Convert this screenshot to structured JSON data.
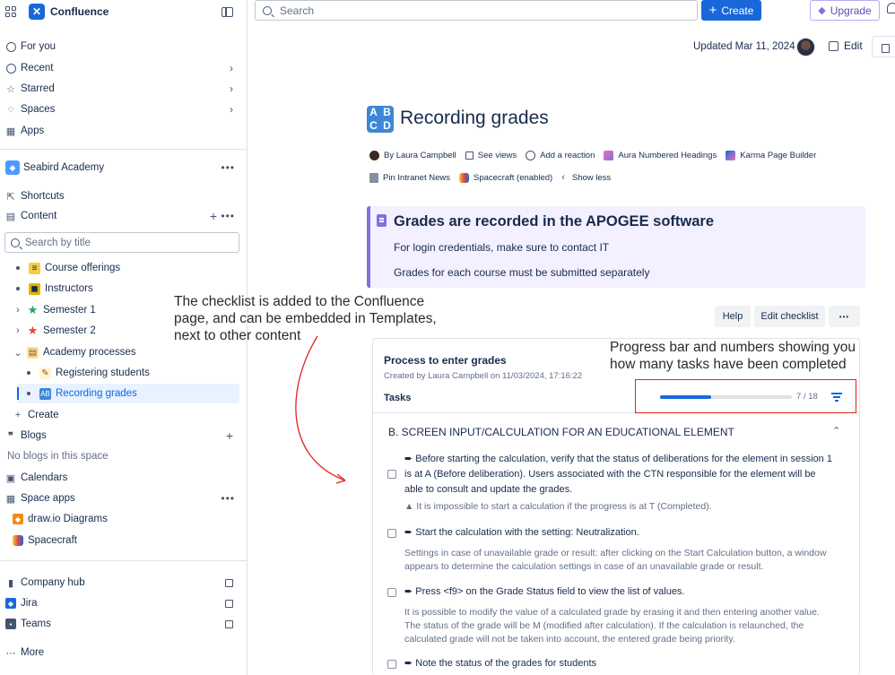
{
  "sidebar": {
    "app_name": "Confluence",
    "nav": [
      {
        "label": "For you"
      },
      {
        "label": "Recent"
      },
      {
        "label": "Starred"
      },
      {
        "label": "Spaces"
      },
      {
        "label": "Apps"
      }
    ],
    "space_name": "Seabird Academy",
    "shortcuts": "Shortcuts",
    "content": "Content",
    "search_placeholder": "Search by title",
    "tree": [
      {
        "label": "Course offerings"
      },
      {
        "label": "Instructors"
      },
      {
        "label": "Semester 1"
      },
      {
        "label": "Semester 2"
      },
      {
        "label": "Academy processes"
      },
      {
        "label": "Registering students"
      },
      {
        "label": "Recording grades"
      }
    ],
    "create": "Create",
    "blogs": "Blogs",
    "no_blogs": "No blogs in this space",
    "calendars": "Calendars",
    "space_apps": "Space apps",
    "apps": [
      {
        "label": "draw.io Diagrams"
      },
      {
        "label": "Spacecraft"
      }
    ],
    "bottom": [
      {
        "label": "Company hub"
      },
      {
        "label": "Jira"
      },
      {
        "label": "Teams"
      }
    ],
    "more": "More"
  },
  "topbar": {
    "search_placeholder": "Search",
    "create_label": "Create",
    "upgrade_label": "Upgrade"
  },
  "header": {
    "updated": "Updated Mar 11, 2024",
    "edit_label": "Edit"
  },
  "page": {
    "emoji": [
      "A",
      "B",
      "C",
      "D"
    ],
    "title": "Recording grades",
    "byline_row1": [
      {
        "label": "By Laura Campbell"
      },
      {
        "label": "See views"
      },
      {
        "label": "Add a reaction"
      },
      {
        "label": "Aura Numbered Headings"
      },
      {
        "label": "Karma Page Builder"
      }
    ],
    "byline_row2": [
      {
        "label": "Pin Intranet News"
      },
      {
        "label": "Spacecraft (enabled)"
      },
      {
        "label": "Show less"
      }
    ],
    "panel": {
      "heading": "Grades are recorded in the APOGEE software",
      "line1": "For login credentials, make sure to contact IT",
      "line2": "Grades for each course must be submitted separately"
    }
  },
  "checklist": {
    "help_label": "Help",
    "edit_label": "Edit checklist",
    "more_label": "•••",
    "title": "Process to enter grades",
    "meta": "Created by Laura Campbell on 11/03/2024, 17:16:22",
    "tasks_label": "Tasks",
    "progress_done": 7,
    "progress_total": 18,
    "progress_text": "7 / 18",
    "section": "B. SCREEN INPUT/CALCULATION FOR AN EDUCATIONAL ELEMENT",
    "items": [
      {
        "text": "➨ Before starting the calculation, verify that the status of deliberations for the element in session 1 is at A (Before deliberation). Users associated with the CTN responsible for the element will be able to consult and update the grades.",
        "note": "▲ It is impossible to start a calculation if the progress is at T (Completed)."
      },
      {
        "text": "➨ Start the calculation with the setting: Neutralization.",
        "note": "Settings in case of unavailable grade or result: after clicking on the Start Calculation button, a window appears to determine the calculation settings in case of an unavailable grade or result."
      },
      {
        "text": "➨ Press <f9> on the Grade Status field to view the list of values.",
        "note": "It is possible to modify the value of a calculated grade by erasing it and then entering another value. The status of the grade will be M (modified after calculation). If the calculation is relaunched, the calculated grade will not be taken into account, the entered grade being priority."
      },
      {
        "text": "➨ Note the status of the grades for students",
        "note": ""
      }
    ]
  },
  "annotations": {
    "left": "The checklist is added to the Confluence page, and can be embedded in Templates, next to other content",
    "right": "Progress bar and numbers showing you how many tasks have been completed"
  },
  "colors": {
    "accent": "#1868db",
    "panel_bg": "#f3f0ff",
    "panel_border": "#8270db",
    "annotation_red": "#e0241b"
  }
}
